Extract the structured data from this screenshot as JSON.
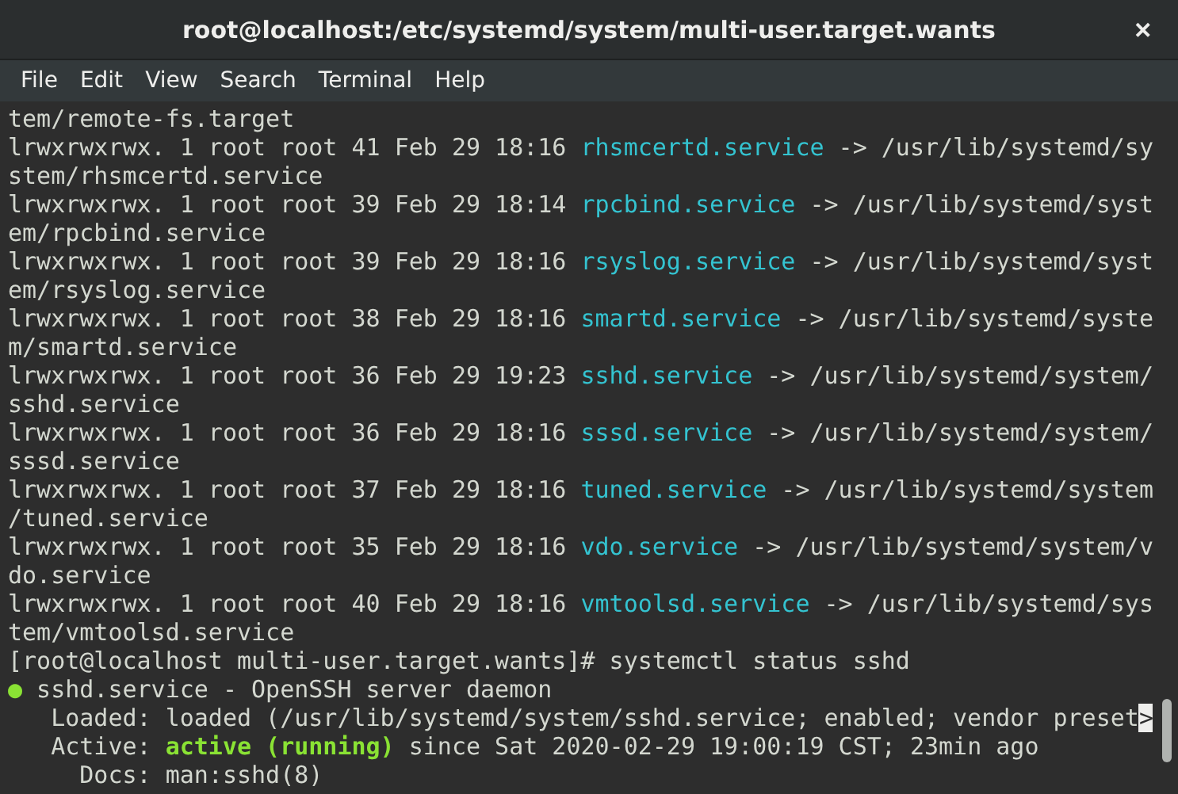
{
  "window": {
    "title": "root@localhost:/etc/systemd/system/multi-user.target.wants",
    "close": "✕"
  },
  "menu": [
    "File",
    "Edit",
    "View",
    "Search",
    "Terminal",
    "Help"
  ],
  "terminal": {
    "lines": [
      [
        {
          "kind": "plain",
          "text": "tem/remote-fs.target"
        }
      ],
      [
        {
          "kind": "plain",
          "text": "lrwxrwxrwx. 1 root root 41 Feb 29 18:16 "
        },
        {
          "kind": "link",
          "text": "rhsmcertd.service"
        },
        {
          "kind": "plain",
          "text": " -> /usr/lib/systemd/sy"
        }
      ],
      [
        {
          "kind": "plain",
          "text": "stem/rhsmcertd.service"
        }
      ],
      [
        {
          "kind": "plain",
          "text": "lrwxrwxrwx. 1 root root 39 Feb 29 18:14 "
        },
        {
          "kind": "link",
          "text": "rpcbind.service"
        },
        {
          "kind": "plain",
          "text": " -> /usr/lib/systemd/syst"
        }
      ],
      [
        {
          "kind": "plain",
          "text": "em/rpcbind.service"
        }
      ],
      [
        {
          "kind": "plain",
          "text": "lrwxrwxrwx. 1 root root 39 Feb 29 18:16 "
        },
        {
          "kind": "link",
          "text": "rsyslog.service"
        },
        {
          "kind": "plain",
          "text": " -> /usr/lib/systemd/syst"
        }
      ],
      [
        {
          "kind": "plain",
          "text": "em/rsyslog.service"
        }
      ],
      [
        {
          "kind": "plain",
          "text": "lrwxrwxrwx. 1 root root 38 Feb 29 18:16 "
        },
        {
          "kind": "link",
          "text": "smartd.service"
        },
        {
          "kind": "plain",
          "text": " -> /usr/lib/systemd/syste"
        }
      ],
      [
        {
          "kind": "plain",
          "text": "m/smartd.service"
        }
      ],
      [
        {
          "kind": "plain",
          "text": "lrwxrwxrwx. 1 root root 36 Feb 29 19:23 "
        },
        {
          "kind": "link",
          "text": "sshd.service"
        },
        {
          "kind": "plain",
          "text": " -> /usr/lib/systemd/system/"
        }
      ],
      [
        {
          "kind": "plain",
          "text": "sshd.service"
        }
      ],
      [
        {
          "kind": "plain",
          "text": "lrwxrwxrwx. 1 root root 36 Feb 29 18:16 "
        },
        {
          "kind": "link",
          "text": "sssd.service"
        },
        {
          "kind": "plain",
          "text": " -> /usr/lib/systemd/system/"
        }
      ],
      [
        {
          "kind": "plain",
          "text": "sssd.service"
        }
      ],
      [
        {
          "kind": "plain",
          "text": "lrwxrwxrwx. 1 root root 37 Feb 29 18:16 "
        },
        {
          "kind": "link",
          "text": "tuned.service"
        },
        {
          "kind": "plain",
          "text": " -> /usr/lib/systemd/system"
        }
      ],
      [
        {
          "kind": "plain",
          "text": "/tuned.service"
        }
      ],
      [
        {
          "kind": "plain",
          "text": "lrwxrwxrwx. 1 root root 35 Feb 29 18:16 "
        },
        {
          "kind": "link",
          "text": "vdo.service"
        },
        {
          "kind": "plain",
          "text": " -> /usr/lib/systemd/system/v"
        }
      ],
      [
        {
          "kind": "plain",
          "text": "do.service"
        }
      ],
      [
        {
          "kind": "plain",
          "text": "lrwxrwxrwx. 1 root root 40 Feb 29 18:16 "
        },
        {
          "kind": "link",
          "text": "vmtoolsd.service"
        },
        {
          "kind": "plain",
          "text": " -> /usr/lib/systemd/sys"
        }
      ],
      [
        {
          "kind": "plain",
          "text": "tem/vmtoolsd.service"
        }
      ],
      [
        {
          "kind": "plain",
          "text": "[root@localhost multi-user.target.wants]# systemctl status sshd"
        }
      ],
      [
        {
          "kind": "dot",
          "text": "●"
        },
        {
          "kind": "plain",
          "text": " sshd.service - OpenSSH server daemon"
        }
      ],
      [
        {
          "kind": "plain",
          "text": "   Loaded: loaded (/usr/lib/systemd/system/sshd.service; enabled; vendor preset"
        },
        {
          "kind": "marker",
          "text": ">"
        }
      ],
      [
        {
          "kind": "plain",
          "text": "   Active: "
        },
        {
          "kind": "ok",
          "text": "active (running)"
        },
        {
          "kind": "plain",
          "text": " since Sat 2020-02-29 19:00:19 CST; 23min ago"
        }
      ],
      [
        {
          "kind": "plain",
          "text": "     Docs: man:sshd(8)"
        }
      ]
    ]
  }
}
